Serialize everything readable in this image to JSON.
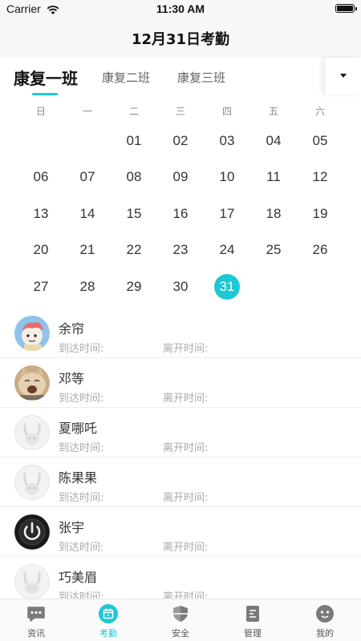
{
  "status_bar": {
    "carrier": "Carrier",
    "time": "11:30 AM"
  },
  "nav": {
    "title": "12月31日考勤"
  },
  "tabs": [
    {
      "label": "康复一班",
      "active": true
    },
    {
      "label": "康复二班",
      "active": false
    },
    {
      "label": "康复三班",
      "active": false
    }
  ],
  "calendar": {
    "weekdays": [
      "日",
      "一",
      "二",
      "三",
      "四",
      "五",
      "六"
    ],
    "days": [
      "",
      "",
      "01",
      "02",
      "03",
      "04",
      "05",
      "06",
      "07",
      "08",
      "09",
      "10",
      "11",
      "12",
      "13",
      "14",
      "15",
      "16",
      "17",
      "18",
      "19",
      "20",
      "21",
      "22",
      "23",
      "24",
      "25",
      "26",
      "27",
      "28",
      "29",
      "30",
      "31",
      "",
      ""
    ],
    "selected": "31",
    "accent": "#1cc8d8"
  },
  "attendance": {
    "arrive_label": "到达时间:",
    "leave_label": "离开时间:",
    "students": [
      {
        "name": "余帘",
        "avatar": "cartoon-avatar"
      },
      {
        "name": "邓等",
        "avatar": "cat-avatar"
      },
      {
        "name": "夏哪吒",
        "avatar": "default-avatar"
      },
      {
        "name": "陈果果",
        "avatar": "default-avatar"
      },
      {
        "name": "张宇",
        "avatar": "power-avatar"
      },
      {
        "name": "巧美眉",
        "avatar": "default-avatar"
      }
    ]
  },
  "tabbar": [
    {
      "label": "资讯",
      "icon": "chat-icon"
    },
    {
      "label": "考勤",
      "icon": "calendar-icon",
      "active": true
    },
    {
      "label": "安全",
      "icon": "shield-icon"
    },
    {
      "label": "管理",
      "icon": "document-icon"
    },
    {
      "label": "我的",
      "icon": "smiley-icon"
    }
  ]
}
